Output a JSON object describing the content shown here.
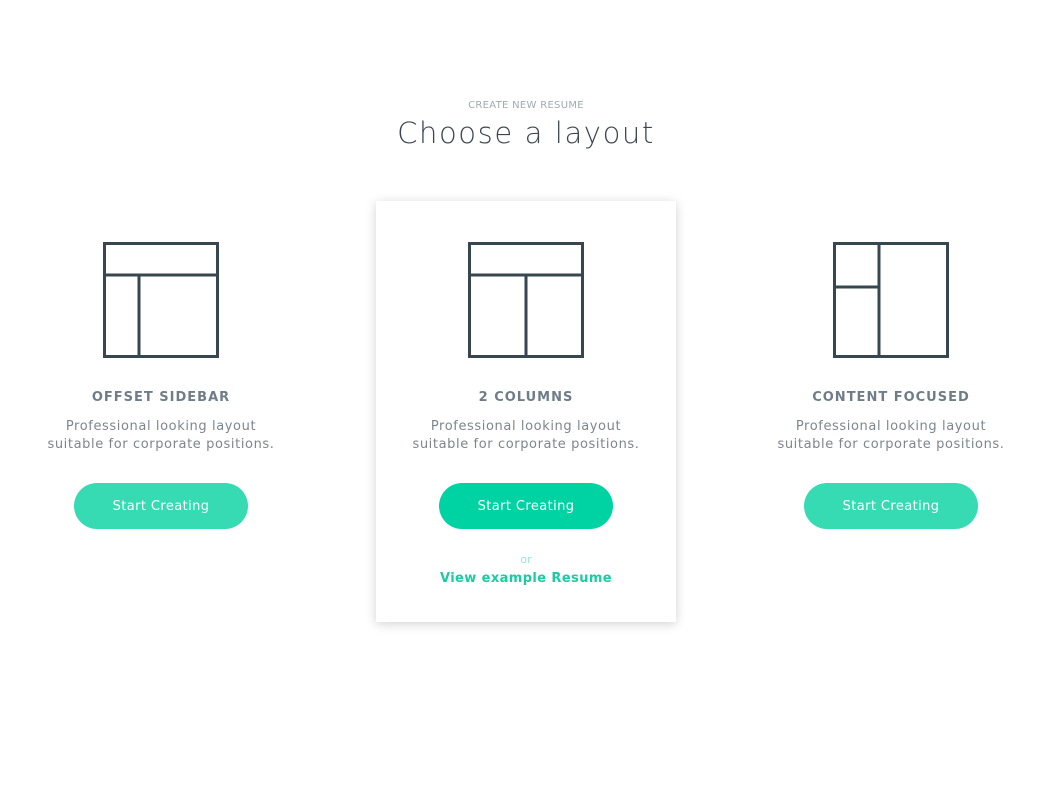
{
  "header": {
    "eyebrow": "CREATE NEW RESUME",
    "title": "Choose a layout"
  },
  "layouts": [
    {
      "title": "OFFSET SIDEBAR",
      "description": "Professional looking layout\nsuitable for corporate positions.",
      "button_label": "Start Creating",
      "icon": "offset-sidebar-layout-icon"
    },
    {
      "title": "2 COLUMNS",
      "description": "Professional looking layout\nsuitable for corporate positions.",
      "button_label": "Start Creating",
      "icon": "two-columns-layout-icon",
      "or_text": "or",
      "example_link": "View example Resume",
      "selected": true
    },
    {
      "title": "CONTENT FOCUSED",
      "description": "Professional looking layout\nsuitable for corporate positions.",
      "button_label": "Start Creating",
      "icon": "content-focused-layout-icon"
    }
  ],
  "colors": {
    "accent": "#00d3a3",
    "accent_light": "#36dab3",
    "icon_stroke": "#37474f",
    "heading": "#3a4750"
  }
}
